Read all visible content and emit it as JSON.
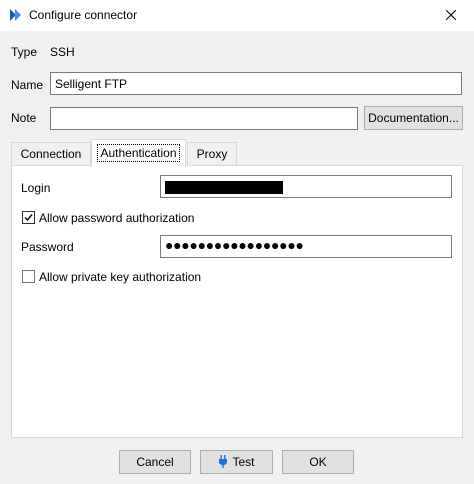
{
  "window": {
    "title": "Configure connector"
  },
  "type_row": {
    "label": "Type",
    "value": "SSH"
  },
  "name_row": {
    "label": "Name",
    "value": "Selligent FTP"
  },
  "note_row": {
    "label": "Note",
    "value": "",
    "doc_button": "Documentation..."
  },
  "tabs": [
    {
      "label": "Connection",
      "active": false
    },
    {
      "label": "Authentication",
      "active": true
    },
    {
      "label": "Proxy",
      "active": false
    }
  ],
  "auth": {
    "login_label": "Login",
    "allow_password": {
      "label": "Allow password authorization",
      "checked": true
    },
    "password_label": "Password",
    "password_mask": "●●●●●●●●●●●●●●●●●",
    "allow_private_key": {
      "label": "Allow private key authorization",
      "checked": false
    }
  },
  "footer": {
    "cancel": "Cancel",
    "test": "Test",
    "ok": "OK"
  },
  "colors": {
    "app_icon": "#1b5fb4",
    "test_icon": "#1a73d9",
    "window_bg": "#f0f0f0"
  }
}
